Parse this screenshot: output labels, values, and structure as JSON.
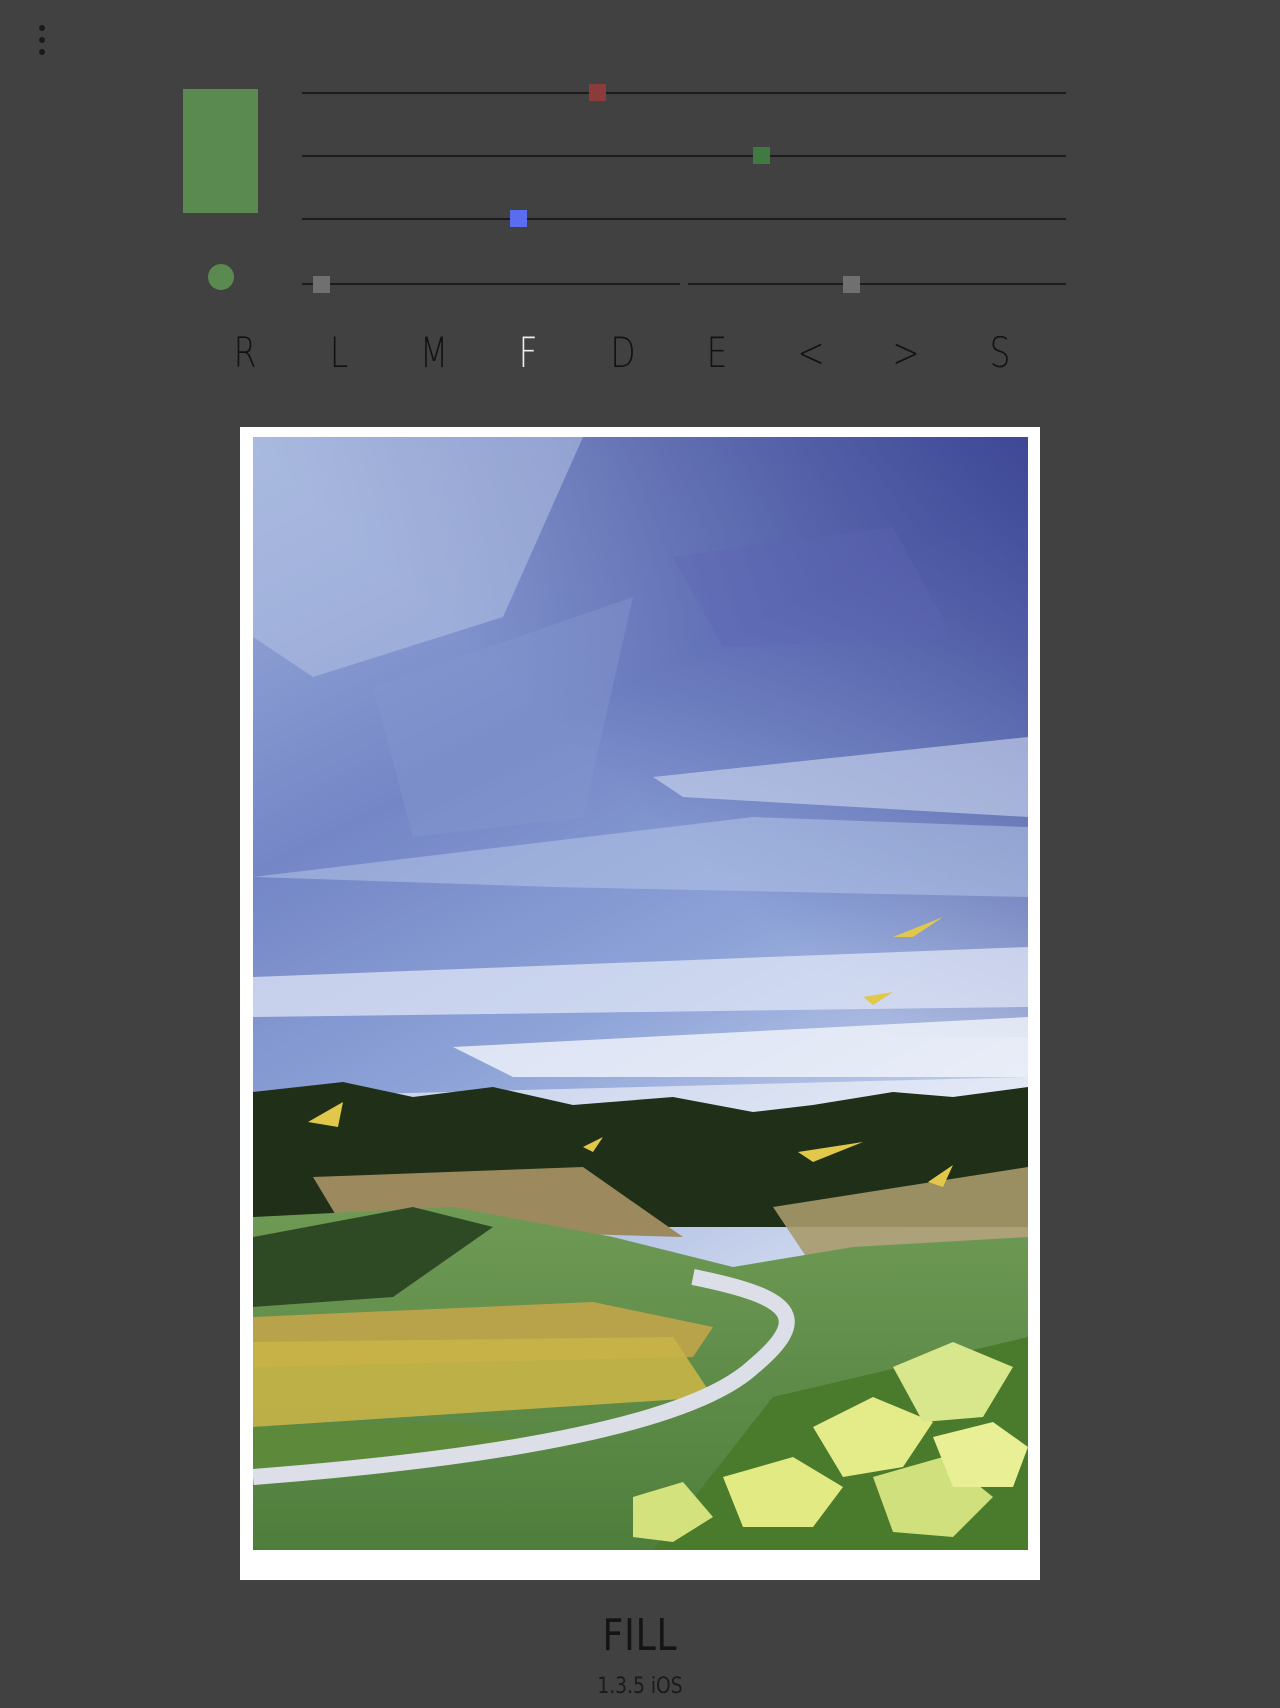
{
  "menu": {
    "icon": "vertical-ellipsis"
  },
  "color": {
    "swatch": "#5a8a50",
    "red": {
      "value": 0.386,
      "knob_color": "#8c3b3b"
    },
    "green": {
      "value": 0.601,
      "knob_color": "#3f7a40"
    },
    "blue": {
      "value": 0.283,
      "knob_color": "#5a6cf0"
    }
  },
  "brush": {
    "dot_color": "#5a8a50",
    "size": {
      "value": 0.05,
      "knob_color": "#707070"
    },
    "opacity": {
      "value": 0.43,
      "knob_color": "#707070"
    }
  },
  "toolbar": {
    "items": [
      {
        "label": "R",
        "active": false
      },
      {
        "label": "L",
        "active": false
      },
      {
        "label": "M",
        "active": false
      },
      {
        "label": "F",
        "active": true
      },
      {
        "label": "D",
        "active": false
      },
      {
        "label": "E",
        "active": false
      },
      {
        "label": "<",
        "active": false
      },
      {
        "label": ">",
        "active": false
      },
      {
        "label": "S",
        "active": false
      }
    ]
  },
  "canvas": {
    "subject": "painted-landscape"
  },
  "footer": {
    "title": "FILL",
    "version": "1.3.5 iOS"
  }
}
